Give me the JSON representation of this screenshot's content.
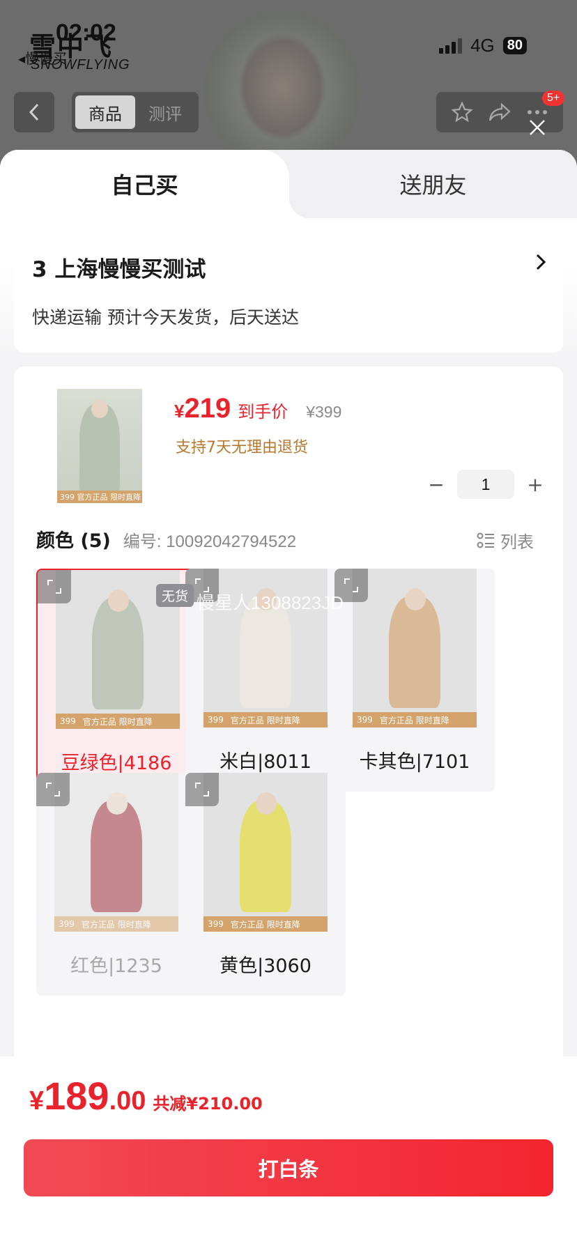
{
  "status_bar": {
    "time": "02:02",
    "back_label": "慢慢买",
    "network": "4G",
    "battery": "80"
  },
  "background": {
    "brand": "雪中飞",
    "brand_sub": "SNOWFLYING"
  },
  "top_nav": {
    "tab_product": "商品",
    "tab_review": "测评",
    "message_badge": "5+"
  },
  "purchase_tabs": {
    "self": "自己买",
    "gift": "送朋友"
  },
  "address": {
    "title": "3  上海慢慢买测试",
    "shipping": "快递运输 预计今天发货，后天送达"
  },
  "product": {
    "currency": "¥",
    "price": "219",
    "price_label": "到手价",
    "original_price": "¥399",
    "return_policy": "支持7天无理由退货",
    "quantity": "1",
    "qty_minus": "−",
    "qty_plus": "+"
  },
  "colors": {
    "title": "颜色 (5)",
    "code_label": "编号:  10092042794522",
    "list_label": "列表",
    "items": [
      {
        "label": "豆绿色|4186",
        "selected": true,
        "available": true,
        "coat_color": "#bfc7ba"
      },
      {
        "label": "米白|8011",
        "selected": false,
        "available": true,
        "coat_color": "#ebe8e1"
      },
      {
        "label": "卡其色|7101",
        "selected": false,
        "available": true,
        "coat_color": "#d9b996"
      },
      {
        "label": "红色|1235",
        "selected": false,
        "available": false,
        "coat_color": "#9e2f3d"
      },
      {
        "label": "黄色|3060",
        "selected": false,
        "available": true,
        "coat_color": "#e4df6e"
      }
    ],
    "no_stock": "无货",
    "strip_price": "399",
    "strip_text": "官方正品 限时直降",
    "watermark": "慢星人1308823JD"
  },
  "checkout": {
    "currency": "¥",
    "final_int": "189",
    "final_dec": ".00",
    "saving": "共减¥210.00",
    "button": "打白条"
  },
  "colors_theme": {
    "accent": "#e8232c",
    "gold": "#b7772e"
  }
}
